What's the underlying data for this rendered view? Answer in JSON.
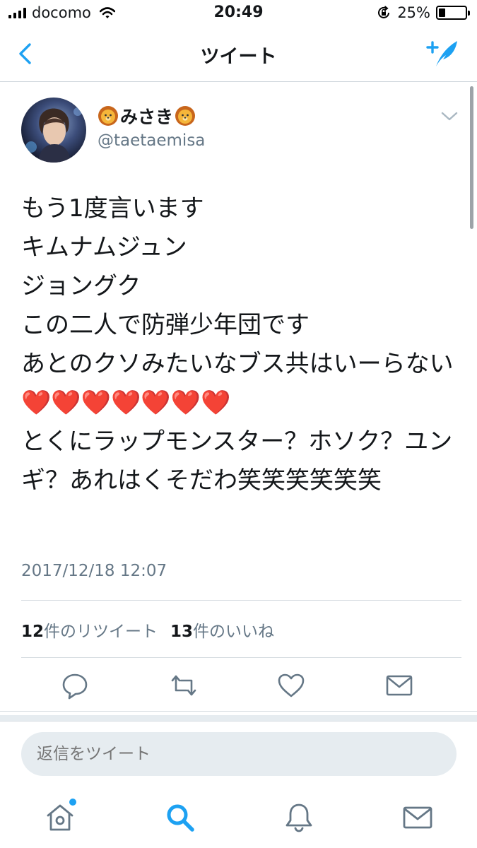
{
  "status_bar": {
    "carrier": "docomo",
    "time": "20:49",
    "battery": "25%",
    "battery_level": 0.25,
    "icons": [
      "signal-icon",
      "wifi-icon",
      "rotation-lock-icon",
      "battery-icon"
    ]
  },
  "nav": {
    "title": "ツイート",
    "back_icon": "chevron-left-icon",
    "compose_icon": "compose-tweet-icon"
  },
  "tweet": {
    "display_name": "みさき",
    "name_emoji": "lion-face",
    "handle": "@taetaemisa",
    "text": "もう1度言います\nキムナムジュン\nジョングク\nこの二人で防弾少年団です\nあとのクソみたいなブス共はいーらない❤️❤️❤️❤️❤️❤️❤️\nとくにラップモンスター？ホソク？ユンギ？あれはくそだわ笑笑笑笑笑笑",
    "timestamp": "2017/12/18 12:07",
    "retweet_count": "12",
    "retweet_label": "件のリツイート",
    "like_count": "13",
    "like_label": "件のいいね"
  },
  "actions": [
    "reply-icon",
    "retweet-icon",
    "like-icon",
    "direct-message-icon"
  ],
  "reply": {
    "placeholder": "返信をツイート"
  },
  "tab_bar": [
    "home-icon",
    "search-icon",
    "notifications-icon",
    "messages-icon"
  ],
  "colors": {
    "accent": "#1da1f2",
    "text": "#14171a",
    "secondary": "#657786",
    "divider": "#d6dce1",
    "reply_bg": "#e6ecf0",
    "heart": "#d0021b"
  }
}
